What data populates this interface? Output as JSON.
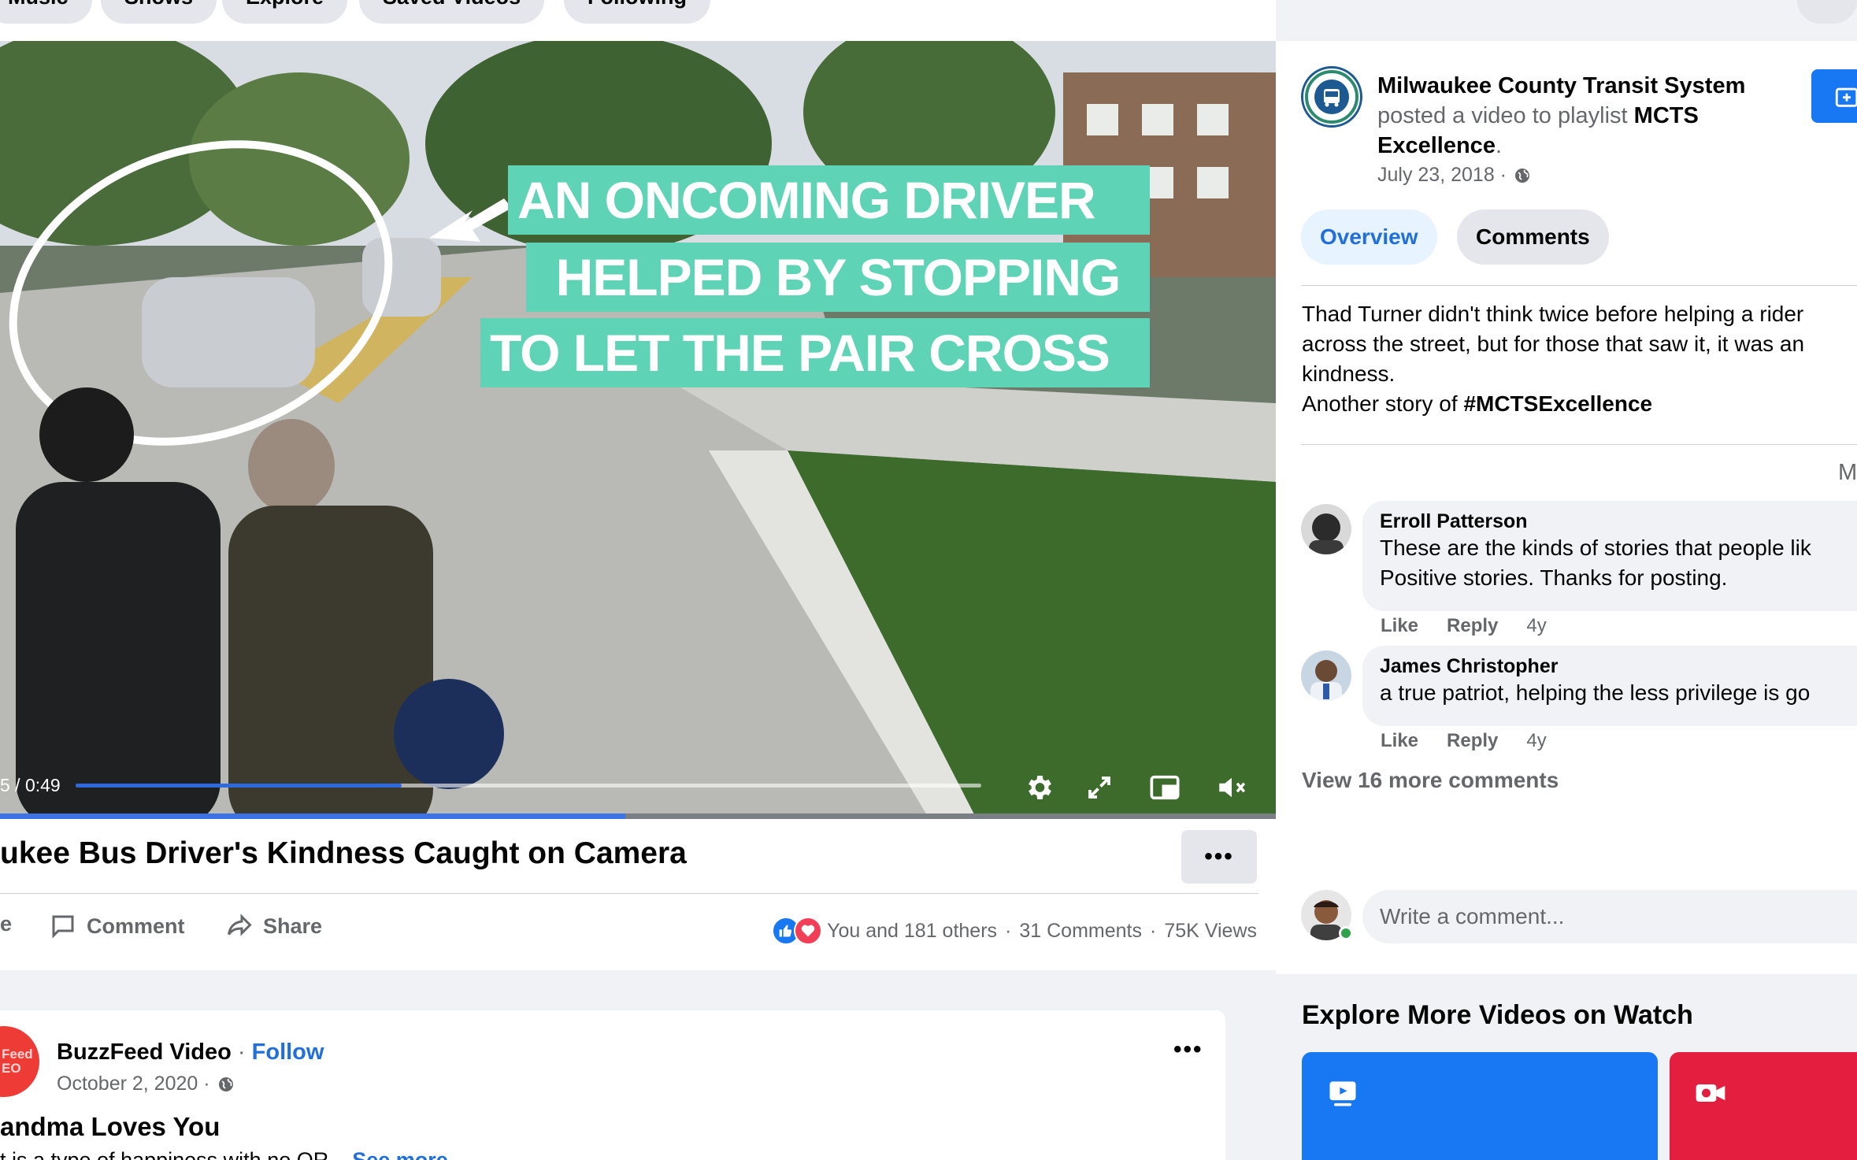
{
  "nav": {
    "pills": [
      "Music",
      "Shows",
      "Explore",
      "Saved Videos",
      "Following"
    ]
  },
  "video": {
    "caption_lines": [
      "AN ONCOMING DRIVER",
      "HELPED BY STOPPING",
      "TO LET THE PAIR CROSS"
    ],
    "time_display": "5 / 0:49",
    "progress_fraction": 0.36,
    "bottom_progress_fraction": 0.49
  },
  "post": {
    "title": "ukee Bus Driver's Kindness Caught on Camera",
    "more_label": "•••",
    "actions": {
      "like_label": "e",
      "comment_label": "Comment",
      "share_label": "Share"
    },
    "stats": {
      "reactions": "You and 181 others",
      "comments": "31 Comments",
      "views": "75K Views",
      "sep": "·"
    }
  },
  "panel": {
    "page_name": "Milwaukee County Transit System",
    "posted_prefix": "posted a video to playlist",
    "playlist": "MCTS Excellence",
    "date": "July 23, 2018 ·",
    "tabs": {
      "overview": "Overview",
      "comments": "Comments"
    },
    "description": {
      "line1": "Thad Turner didn't think twice before helping a rider",
      "line2": "across the street, but for those that saw it, it was an",
      "line3": "kindness.",
      "line4_prefix": "Another story of",
      "hashtag": "#MCTSExcellence"
    },
    "m_label": "M",
    "comments": [
      {
        "name": "Erroll Patterson",
        "text_lines": [
          "These are the kinds of stories that people lik",
          "Positive stories. Thanks for posting."
        ],
        "like": "Like",
        "reply": "Reply",
        "age": "4y"
      },
      {
        "name": "James Christopher",
        "text_lines": [
          "a true patriot, helping the less privilege is go"
        ],
        "like": "Like",
        "reply": "Reply",
        "age": "4y"
      }
    ],
    "view_more": "View 16 more comments",
    "write_placeholder": "Write a comment..."
  },
  "explore": {
    "title": "Explore More Videos on Watch"
  },
  "post2": {
    "avatar_text": "Feed EO",
    "author": "BuzzFeed Video",
    "dot": "·",
    "follow": "Follow",
    "date": "October 2, 2020 ·",
    "more_label": "•••",
    "title": "andma Loves You",
    "snippet": "t is a type of happiness with no OR...",
    "see_more": "See more"
  },
  "colors": {
    "accent": "#216fdb",
    "caption_bg": "#5fd3b5",
    "like_blue": "#1877f2",
    "love_red": "#f33e58"
  }
}
